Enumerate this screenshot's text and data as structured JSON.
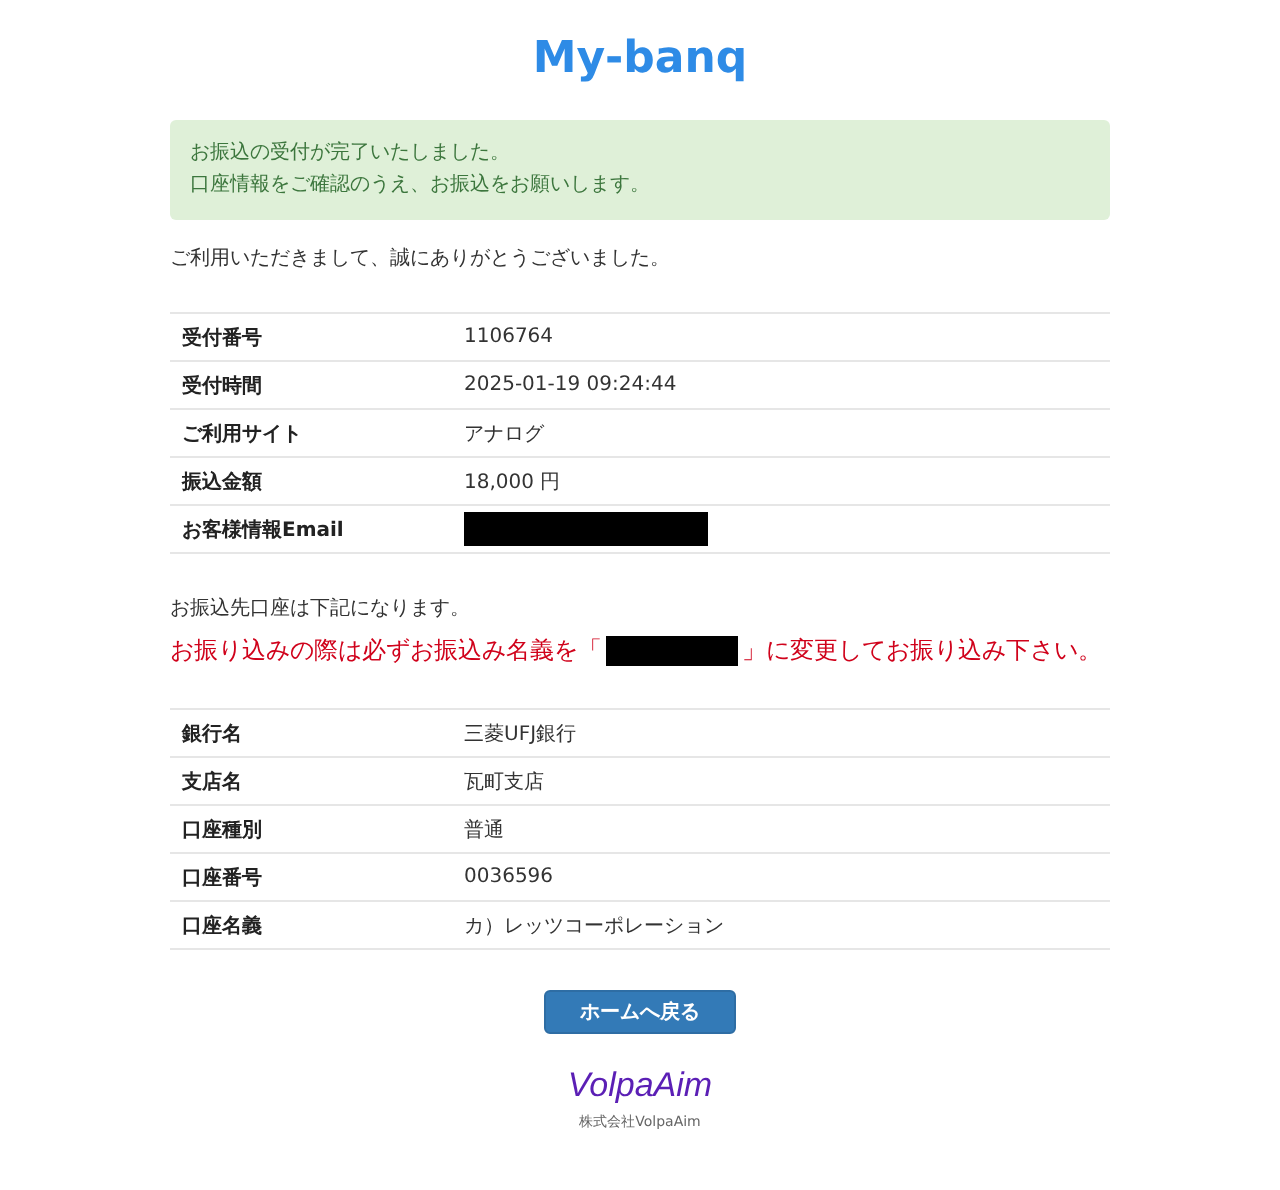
{
  "brand": "My-banq",
  "alert": [
    "お振込の受付が完了いたしました。",
    "口座情報をご確認のうえ、お振込をお願いします。"
  ],
  "thanks": "ご利用いただきまして、誠にありがとうございました。",
  "order_table": [
    {
      "label": "受付番号",
      "kind": "text",
      "value": "1106764"
    },
    {
      "label": "受付時間",
      "kind": "text",
      "value": "2025-01-19 09:24:44"
    },
    {
      "label": "ご利用サイト",
      "kind": "text",
      "value": "アナログ"
    },
    {
      "label": "振込金額",
      "kind": "text",
      "value": "18,000 円"
    },
    {
      "label": "お客様情報Email",
      "kind": "redacted"
    }
  ],
  "account_note": "お振込先口座は下記になります。",
  "warning": [
    {
      "kind": "text",
      "text": "お振り込みの際は必ずお振込み名義を「"
    },
    {
      "kind": "redacted"
    },
    {
      "kind": "text",
      "text": "」に変更してお振り込み下さい。"
    }
  ],
  "account_table": [
    {
      "label": "銀行名",
      "kind": "text",
      "value": "三菱UFJ銀行"
    },
    {
      "label": "支店名",
      "kind": "text",
      "value": "瓦町支店"
    },
    {
      "label": "口座種別",
      "kind": "text",
      "value": "普通"
    },
    {
      "label": "口座番号",
      "kind": "text",
      "value": "0036596"
    },
    {
      "label": "口座名義",
      "kind": "text",
      "value": "カ）レッツコーポレーション"
    }
  ],
  "home_button": "ホームへ戻る",
  "footer": {
    "logo": "VolpaAim",
    "company": "株式会社VolpaAim"
  }
}
